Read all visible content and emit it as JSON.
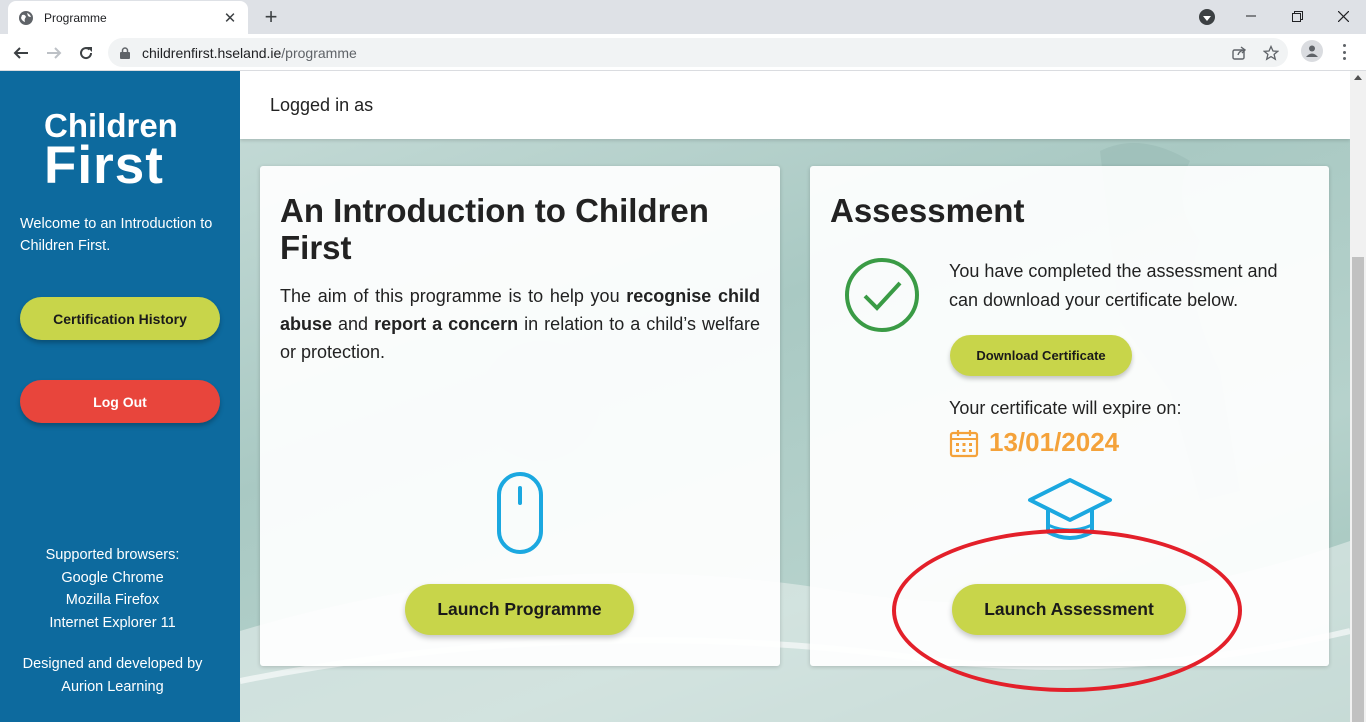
{
  "browser": {
    "tab_title": "Programme",
    "url_host": "childrenfirst.hseland.ie",
    "url_path": "/programme"
  },
  "sidebar": {
    "logo_top": "Children",
    "logo_bottom": "First",
    "welcome": "Welcome to an Introduction to Children First.",
    "cert_history_label": "Certification History",
    "logout_label": "Log Out",
    "browsers_heading": "Supported browsers:",
    "browsers": [
      "Google Chrome",
      "Mozilla Firefox",
      "Internet Explorer 11"
    ],
    "credits_line1": "Designed and developed by",
    "credits_line2": "Aurion Learning"
  },
  "header": {
    "logged_in": "Logged in as"
  },
  "programme_card": {
    "title": "An Introduction to Children First",
    "desc_1": "The aim of this programme is to help you ",
    "desc_bold_1": "recognise child abuse",
    "desc_2": " and ",
    "desc_bold_2": "report a concern",
    "desc_3": " in relation to a child’s welfare or protection.",
    "launch_label": "Launch Programme"
  },
  "assessment_card": {
    "title": "Assessment",
    "completed_text": "You have completed the assessment and can download your certificate below.",
    "download_label": "Download Certificate",
    "expire_label": "Your certificate will expire on:",
    "expiry_date": "13/01/2024",
    "launch_label": "Launch Assessment"
  },
  "colors": {
    "sidebar": "#0d6a9e",
    "button_green": "#c8d54a",
    "logout_red": "#e8453c",
    "check_green": "#3a9b45",
    "date_orange": "#f4a23a",
    "icon_blue": "#1ba8e0",
    "annotation_red": "#e3202a"
  }
}
